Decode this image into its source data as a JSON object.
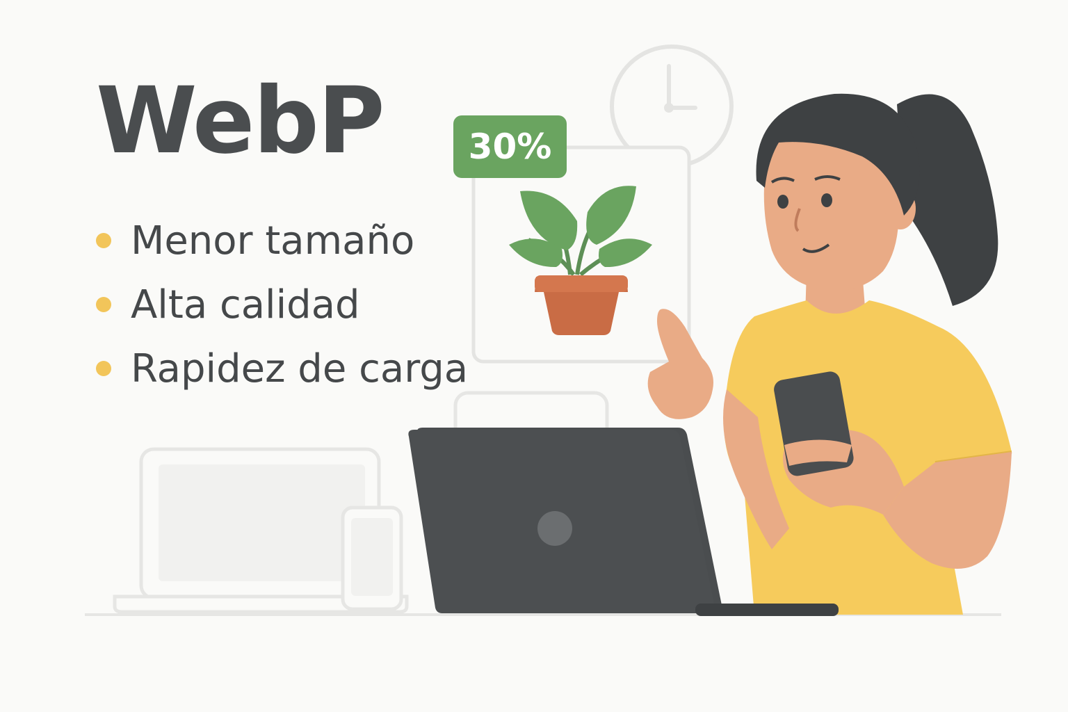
{
  "title": "WebP",
  "bullets": [
    {
      "text": "Menor tamaño"
    },
    {
      "text": "Alta calidad"
    },
    {
      "text": "Rapidez de carga"
    }
  ],
  "badge": {
    "text": "30%"
  },
  "colors": {
    "text": "#4a4d4f",
    "bullet_dot": "#f2c55a",
    "badge_bg": "#6aa460",
    "shirt": "#f6cb5c",
    "skin": "#e9ab86",
    "hair": "#3e4143",
    "laptop": "#4a4d4f",
    "plant_leaf": "#6aa460",
    "pot": "#c96c45",
    "outline": "#e4e4e2"
  },
  "icons": [
    "clock-icon",
    "image-card-icon",
    "plant-icon",
    "laptop-icon",
    "phone-icon",
    "tablet-icon",
    "monitor-icon"
  ]
}
